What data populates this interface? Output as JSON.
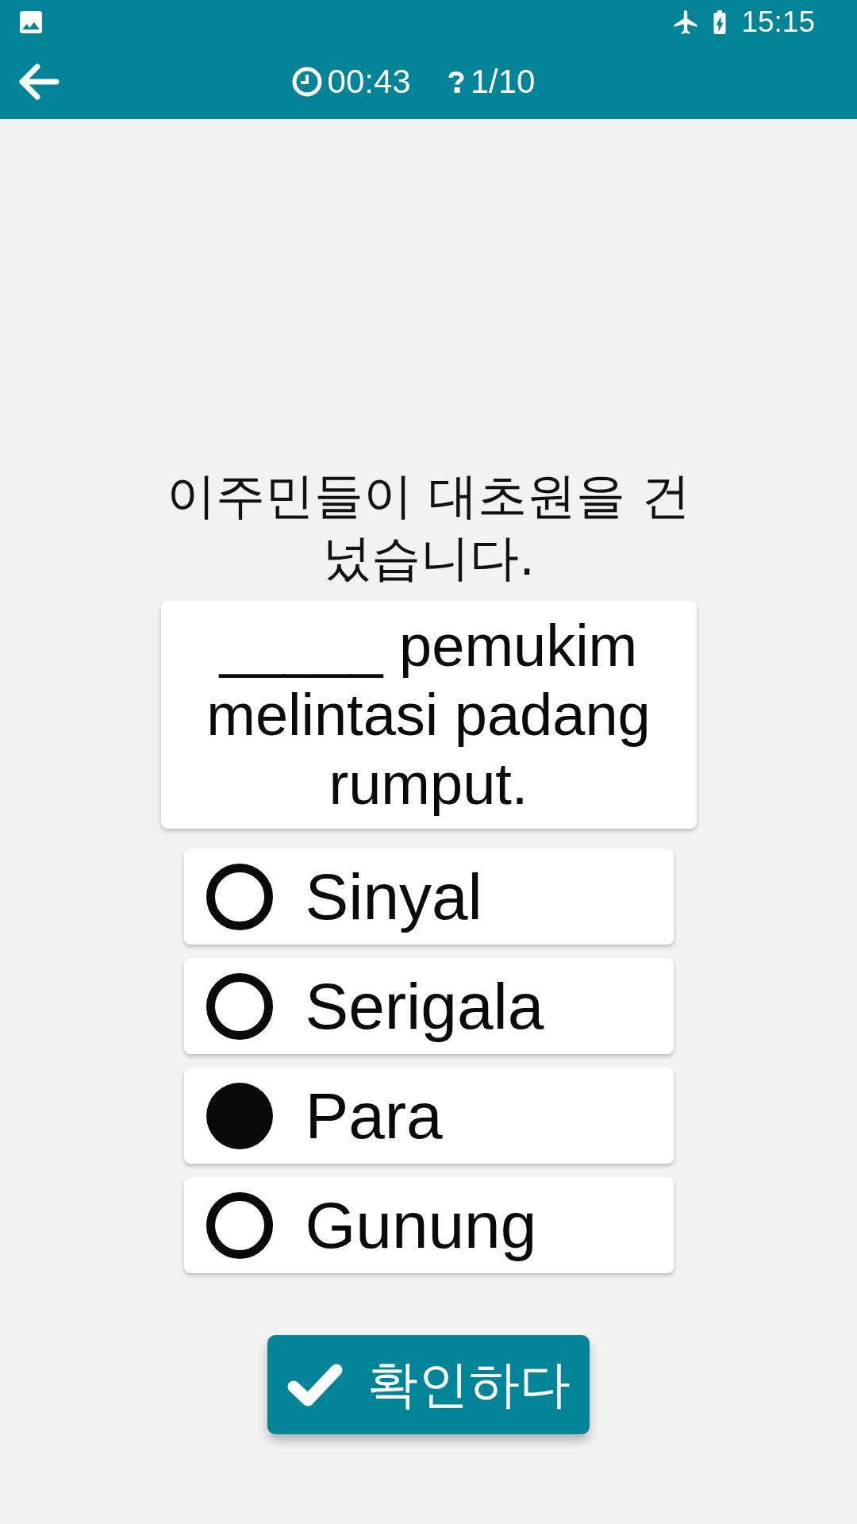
{
  "status_bar": {
    "time": "15:15"
  },
  "toolbar": {
    "timer": "00:43",
    "progress": "1/10"
  },
  "question": {
    "prompt": "이주민들이 대초원을 건넜습니다.",
    "sentence": "_____ pemukim melintasi padang rumput."
  },
  "options": [
    {
      "label": "Sinyal",
      "selected": false
    },
    {
      "label": "Serigala",
      "selected": false
    },
    {
      "label": "Para",
      "selected": true
    },
    {
      "label": "Gunung",
      "selected": false
    }
  ],
  "confirm_button": {
    "label": "확인하다"
  }
}
